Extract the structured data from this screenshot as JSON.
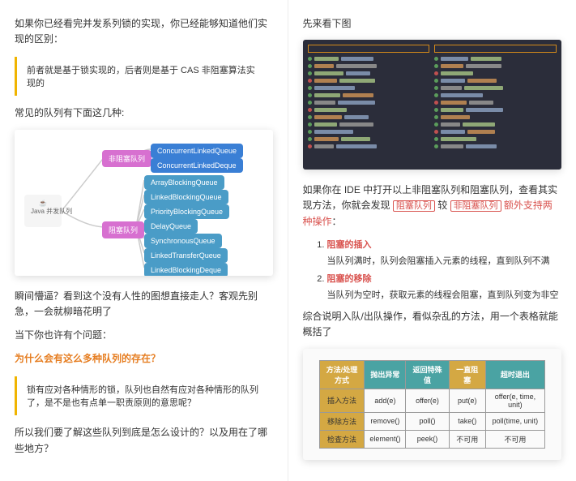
{
  "left": {
    "intro": "如果你已经看完并发系列锁的实现，你已经能够知道他们实现的区别：",
    "quote": "前者就是基于锁实现的，后者则是基于 CAS 非阻塞算法实现的",
    "common_queues_title": "常见的队列有下面这几种:",
    "mindmap": {
      "root": "Java 并发队列",
      "nonblocking_label": "非阻塞队列",
      "nonblocking": [
        "ConcurrentLinkedQueue",
        "ConcurrentLinkedDeque"
      ],
      "blocking_label": "阻塞队列",
      "blocking": [
        "ArrayBlockingQueue",
        "LinkedBlockingQueue",
        "PriorityBlockingQueue",
        "DelayQueue",
        "SynchronousQueue",
        "LinkedTransferQueue",
        "LinkedBlockingDeque"
      ]
    },
    "instant": "瞬间懵逼？看到这个没有人性的图想直接走人？客观先别急，一会就柳暗花明了",
    "maybe_q": "当下你也许有个问题：",
    "why": "为什么会有这么多种队列的存在？",
    "quote2": "锁有应对各种情形的锁，队列也自然有应对各种情形的队列了，是不是也有点单一职责原则的意思呢？",
    "outro": "所以我们要了解这些队列到底是怎么设计的？以及用在了哪些地方？"
  },
  "right": {
    "look": "先来看下图",
    "ide_note_1": "如果你在 IDE 中打开以上非阻塞队列和阻塞队列，查看其实现方法，你就会发现",
    "box1": "阻塞队列",
    "joiner": "较",
    "box2": "非阻塞队列",
    "extra": "额外支持两种操作",
    "colon": "：",
    "ops": [
      {
        "title": "阻塞的插入",
        "desc": "当队列满时，队列会阻塞插入元素的线程，直到队列不满"
      },
      {
        "title": "阻塞的移除",
        "desc": "当队列为空时，获取元素的线程会阻塞，直到队列变为非空"
      }
    ],
    "table_intro": "综合说明入队/出队操作，看似杂乱的方法，用一个表格就能概括了",
    "table": {
      "headers": [
        "方法/处理方式",
        "抛出异常",
        "返回特殊值",
        "一直阻塞",
        "超时退出"
      ],
      "rows": [
        [
          "插入方法",
          "add(e)",
          "offer(e)",
          "put(e)",
          "offer(e, time, unit)"
        ],
        [
          "移除方法",
          "remove()",
          "poll()",
          "take()",
          "poll(time, unit)"
        ],
        [
          "检查方法",
          "element()",
          "peek()",
          "不可用",
          "不可用"
        ]
      ]
    }
  }
}
